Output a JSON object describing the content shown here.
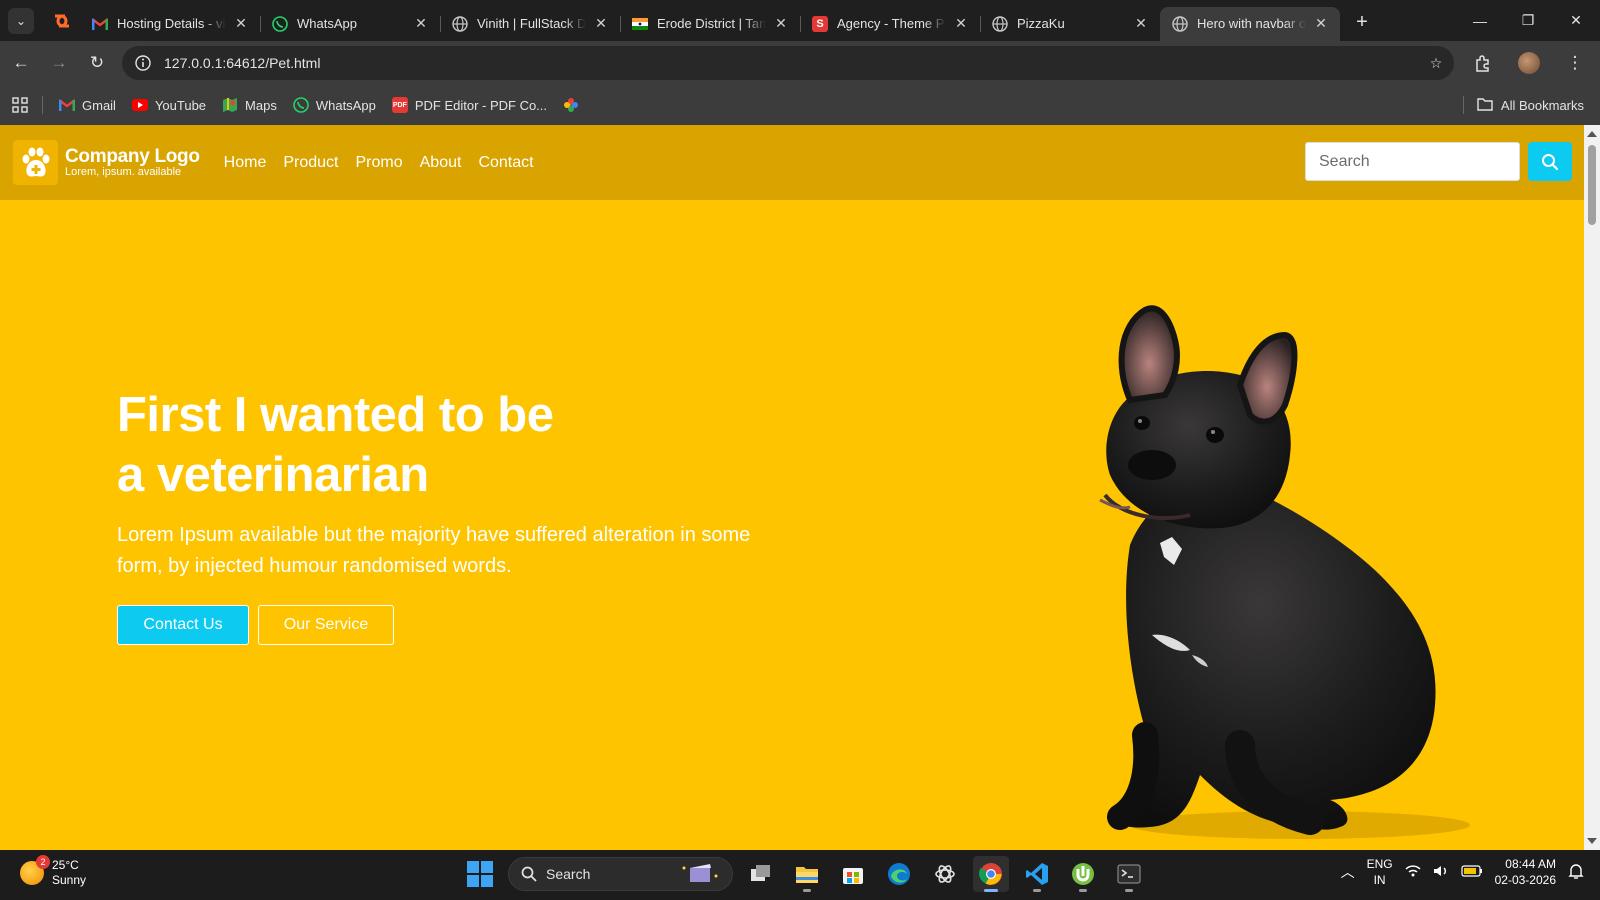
{
  "browser": {
    "tabs": [
      {
        "title": "Hosting Details - vin",
        "favicon": "gmail-icon",
        "color": "#ea4335"
      },
      {
        "title": "WhatsApp",
        "favicon": "whatsapp-icon",
        "color": "#25d366"
      },
      {
        "title": "Vinith | FullStack De",
        "favicon": "globe-icon",
        "color": "#bbbbbb"
      },
      {
        "title": "Erode District | Tami",
        "favicon": "india-flag-icon",
        "color": "#ff9933"
      },
      {
        "title": "Agency - Theme Pro",
        "favicon": "s-logo-icon",
        "color": "#e53935"
      },
      {
        "title": "PizzaKu",
        "favicon": "globe-icon",
        "color": "#bbbbbb"
      },
      {
        "title": "Hero with navbar on",
        "favicon": "globe-icon",
        "color": "#bbbbbb"
      }
    ],
    "url": "127.0.0.1:64612/Pet.html",
    "bookmarks": [
      {
        "label": "Gmail",
        "icon": "gmail-icon"
      },
      {
        "label": "YouTube",
        "icon": "youtube-icon"
      },
      {
        "label": "Maps",
        "icon": "maps-icon"
      },
      {
        "label": "WhatsApp",
        "icon": "whatsapp-icon"
      },
      {
        "label": "PDF Editor - PDF Co...",
        "icon": "pdf-icon"
      },
      {
        "label": "",
        "icon": "photos-icon"
      }
    ],
    "all_bookmarks": "All Bookmarks"
  },
  "page": {
    "logo": {
      "title": "Company Logo",
      "subtitle": "Lorem, ipsum. available"
    },
    "nav": [
      "Home",
      "Product",
      "Promo",
      "About",
      "Contact"
    ],
    "search_placeholder": "Search",
    "hero": {
      "title_line1": "First I wanted to be",
      "title_line2": "a veterinarian",
      "text": "Lorem Ipsum available but the majority have suffered alteration in some form, by injected humour randomised words.",
      "btn_primary": "Contact Us",
      "btn_secondary": "Our Service"
    },
    "colors": {
      "bg": "#ffc400",
      "navbar": "#d9a300",
      "accent": "#0dcaf0"
    }
  },
  "taskbar": {
    "weather_temp": "25°C",
    "weather_desc": "Sunny",
    "weather_badge": "2",
    "search_label": "Search",
    "lang_top": "ENG",
    "lang_bottom": "IN",
    "time": "08:44 AM",
    "date": "02-03-2026"
  }
}
